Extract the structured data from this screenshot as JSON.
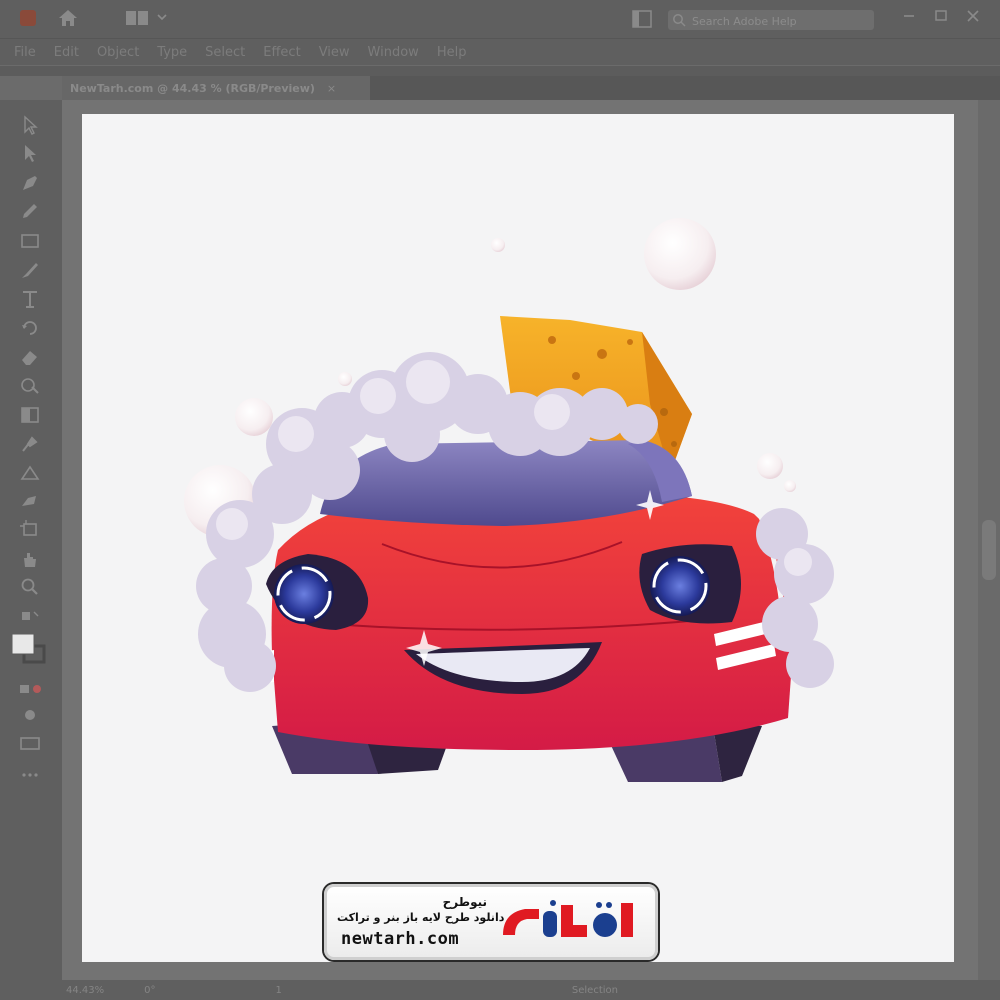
{
  "window": {
    "search_placeholder": "Search Adobe Help"
  },
  "menu": [
    "File",
    "Edit",
    "Object",
    "Type",
    "Select",
    "Effect",
    "View",
    "Window",
    "Help"
  ],
  "document_tab": {
    "title": "NewTarh.com @ 44.43 % (RGB/Preview)",
    "close": "×"
  },
  "status": {
    "zoom": "44.43%",
    "rotation": "0°",
    "artboard": "1",
    "tool": "Selection"
  },
  "watermark": {
    "title": "نیوطرح",
    "subtitle": "دانلود طرح لایه باز بنر و تراکت",
    "url": "newtarh.com"
  },
  "colors": {
    "chrome": "#5f5f5f",
    "canvas": "#737373",
    "artboard": "#f4f4f5",
    "car_red": "#e5283a",
    "sponge": "#f2a11c",
    "foam": "#d9d2e6",
    "logo_red": "#e01a22",
    "logo_blue": "#1b3f8f"
  }
}
